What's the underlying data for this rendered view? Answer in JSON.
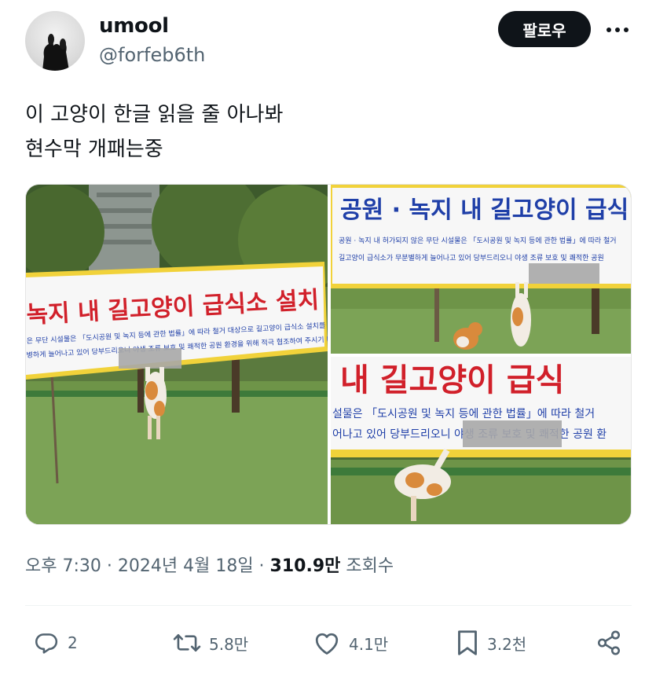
{
  "user": {
    "display_name": "umool",
    "handle": "@forfeb6th",
    "avatar_icon": "avatar-image"
  },
  "header": {
    "follow_label": "팔로우",
    "more_icon": "more-icon"
  },
  "tweet": {
    "lines": [
      "이 고양이 한글 읽을 줄 아나봐",
      "현수막 개패는중"
    ]
  },
  "media": {
    "banner_title_1": "녹지 내 길고양이 급식소 설치 금지",
    "banner_body_1a": "은 무단 시설물은 「도시공원 및 녹지 등에 관한 법률」에 따라 철거 대상으로 길고양이 급식소 설치를 금지합니다.",
    "banner_body_1b": "병하게 늘어나고 있어 당부드리오니 야생 조류 보호 및 쾌적한 공원 환경을 위해 적극 협조하여 주시기 바랍니다.",
    "banner_title_2": "공원 · 녹지 내 길고양이 급식",
    "banner_body_2a": "공원 · 녹지 내 허가되지 않은 무단 시설물은 「도시공원 및 녹지 등에 관한 법률」에 따라 철거",
    "banner_body_2b": "길고양이 급식소가 무분별하게 늘어나고 있어 당부드리오니 야생 조류 보호 및 쾌적한 공원",
    "banner_title_3": "내 길고양이 급식",
    "banner_body_3a": "설물은 「도시공원 및 녹지 등에 관한 법률」에 따라 철거",
    "banner_body_3b": "어나고 있어 당부드리오니 야생 조류 보호 및 쾌적한 공원 환"
  },
  "meta": {
    "time": "오후 7:30",
    "sep1": " · ",
    "date": "2024년 4월 18일",
    "sep2": " · ",
    "views": "310.9만",
    "views_label": " 조회수"
  },
  "actions": {
    "reply_count": "2",
    "retweet_count": "5.8만",
    "like_count": "4.1만",
    "bookmark_count": "3.2천"
  },
  "colors": {
    "banner_red": "#d1202a",
    "banner_blue": "#1f3fa8",
    "banner_yellow": "#f1d23a",
    "icon_gray": "#536471",
    "follow_bg": "#0f1419"
  }
}
